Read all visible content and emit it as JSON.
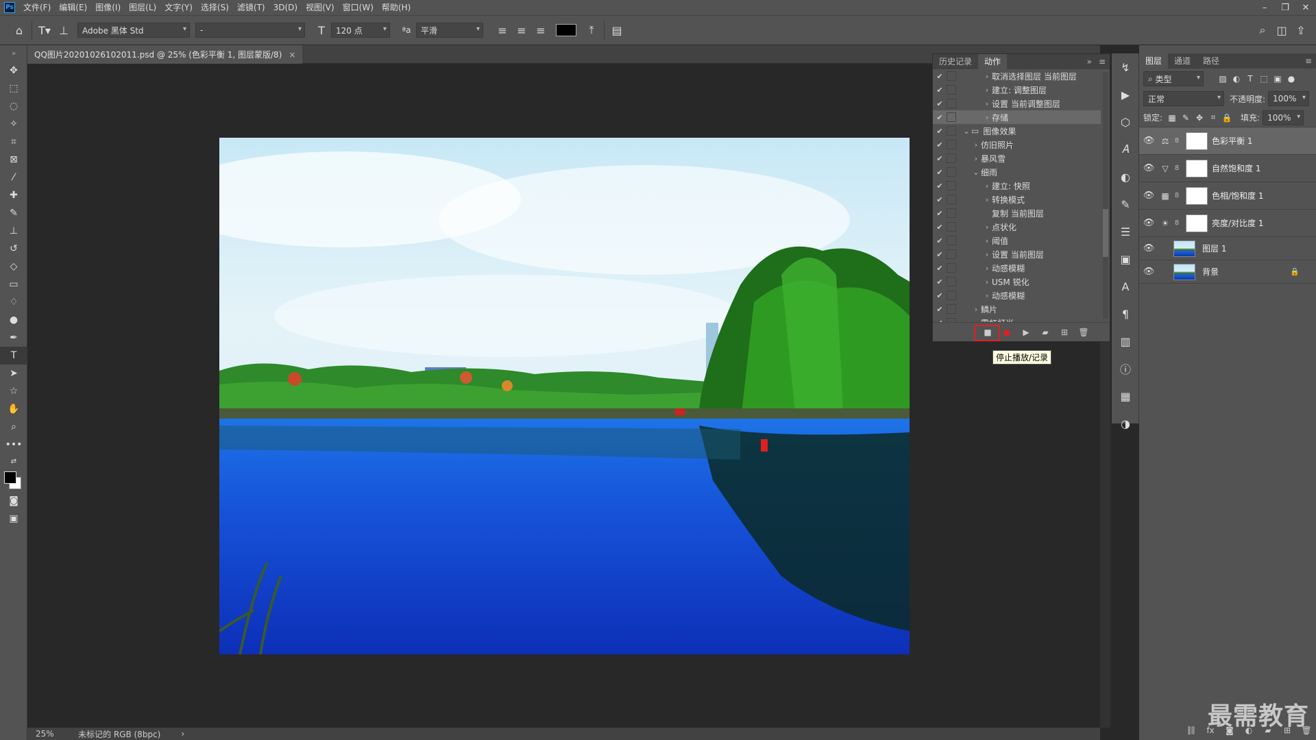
{
  "app": {
    "logo": "Ps"
  },
  "menu": [
    "文件(F)",
    "编辑(E)",
    "图像(I)",
    "图层(L)",
    "文字(Y)",
    "选择(S)",
    "滤镜(T)",
    "3D(D)",
    "视图(V)",
    "窗口(W)",
    "帮助(H)"
  ],
  "window_controls": {
    "minimize": "–",
    "restore": "❐",
    "close": "✕"
  },
  "options": {
    "font_family": "Adobe 黑体 Std",
    "font_style": "-",
    "font_size": "120 点",
    "aa_label": "ªa",
    "antialias": "平滑",
    "text_color": "#000000"
  },
  "document": {
    "tab": "QQ图片20201026102011.psd @ 25% (色彩平衡 1, 图层蒙版/8)",
    "close": "×"
  },
  "status": {
    "zoom": "25%",
    "info": "未标记的 RGB (8bpc)",
    "arrow": "›"
  },
  "actions_panel": {
    "tabs": [
      "历史记录",
      "动作"
    ],
    "rows": [
      {
        "label": "取消选择图层 当前图层",
        "level": 2
      },
      {
        "label": "建立: 调整图层",
        "level": 2
      },
      {
        "label": "设置 当前调整图层",
        "level": 2
      },
      {
        "label": "存储",
        "level": 2
      },
      {
        "label": "图像效果",
        "level": 0
      },
      {
        "label": "仿旧照片",
        "level": 1
      },
      {
        "label": "暴风雪",
        "level": 1
      },
      {
        "label": "细雨",
        "level": 1
      },
      {
        "label": "建立: 快照",
        "level": 2
      },
      {
        "label": "转换模式",
        "level": 2
      },
      {
        "label": "复制 当前图层",
        "level": 2
      },
      {
        "label": "点状化",
        "level": 2
      },
      {
        "label": "阈值",
        "level": 2
      },
      {
        "label": "设置 当前图层",
        "level": 2
      },
      {
        "label": "动感模糊",
        "level": 2
      },
      {
        "label": "USM 锐化",
        "level": 2
      },
      {
        "label": "动感模糊",
        "level": 2
      },
      {
        "label": "鳞片",
        "level": 1
      },
      {
        "label": "霓虹灯光",
        "level": 1
      }
    ],
    "tooltip": "停止播放/记录"
  },
  "layers_panel": {
    "tabs": [
      "图层",
      "通道",
      "路径"
    ],
    "filter_label": "类型",
    "blend_mode": "正常",
    "opacity_label": "不透明度:",
    "opacity": "100%",
    "lock_label": "锁定:",
    "fill_label": "填充:",
    "fill": "100%",
    "layers": [
      {
        "name": "色彩平衡 1",
        "icon": "⚖"
      },
      {
        "name": "自然饱和度 1",
        "icon": "▽"
      },
      {
        "name": "色相/饱和度 1",
        "icon": "▦"
      },
      {
        "name": "亮度/对比度 1",
        "icon": "☀"
      },
      {
        "name": "图层 1"
      },
      {
        "name": "背景"
      }
    ]
  },
  "watermark": "最需教育"
}
